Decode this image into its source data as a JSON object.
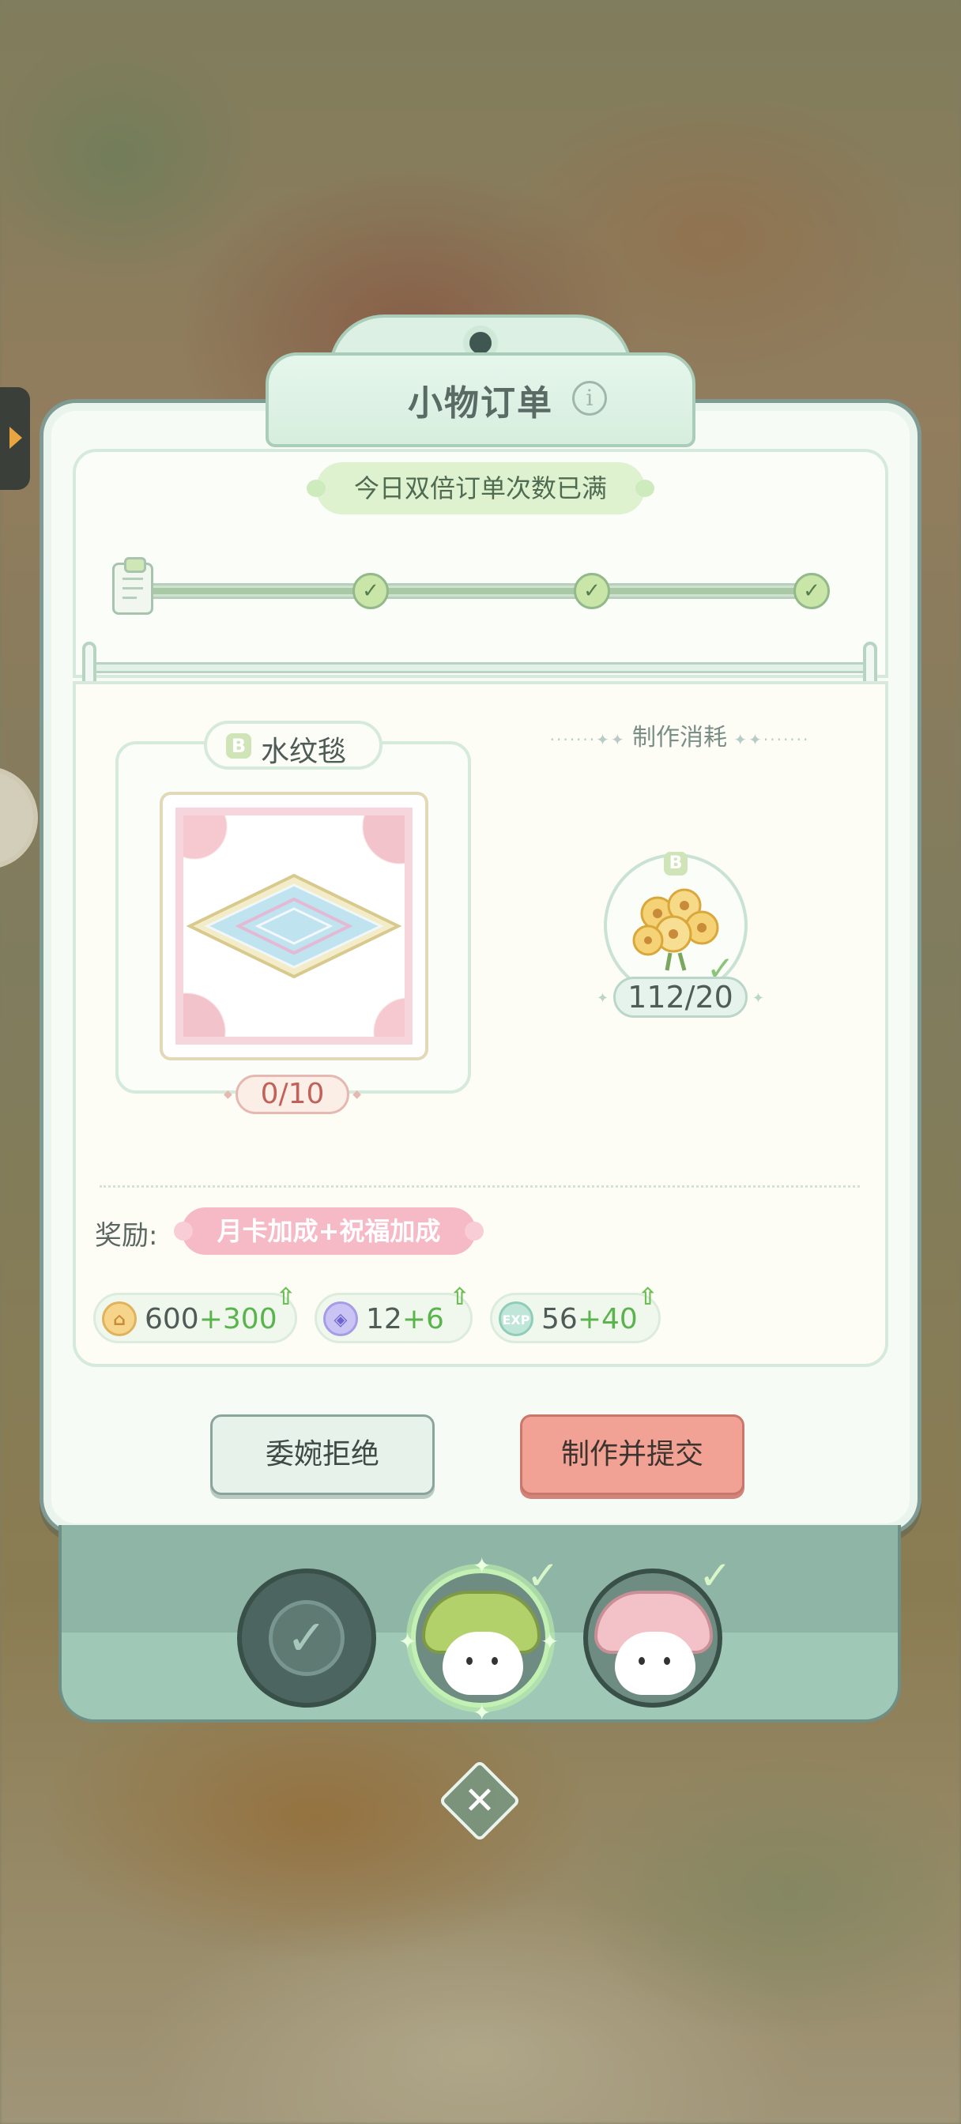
{
  "dialog": {
    "title": "小物订单",
    "info_icon": "info-icon",
    "double_order_notice": "今日双倍订单次数已满"
  },
  "progress": {
    "checkpoints_completed": 3,
    "checkpoints_total": 3
  },
  "item": {
    "rarity": "B",
    "name": "水纹毯",
    "count": "0/10"
  },
  "crafting": {
    "header": "制作消耗",
    "material": {
      "rarity": "B",
      "icon": "flower-bouquet-icon",
      "count": "112/20",
      "sufficient": true
    }
  },
  "rewards": {
    "label": "奖励:",
    "bonus_banner": "月卡加成+祝福加成",
    "items": [
      {
        "icon": "coin-icon",
        "base": "600",
        "bonus": "+300"
      },
      {
        "icon": "gem-icon",
        "base": "12",
        "bonus": "+6"
      },
      {
        "icon": "exp-icon",
        "base": "56",
        "bonus": "+40"
      }
    ]
  },
  "buttons": {
    "decline": "委婉拒绝",
    "submit": "制作并提交"
  },
  "characters": {
    "slots": [
      "completed-slot",
      "green-mushroom",
      "pink-mushroom"
    ],
    "selected_index": 1
  },
  "colors": {
    "accent_green": "#5ab34d",
    "submit_red": "#f2a294",
    "bonus_pink": "#f6b9c6"
  }
}
